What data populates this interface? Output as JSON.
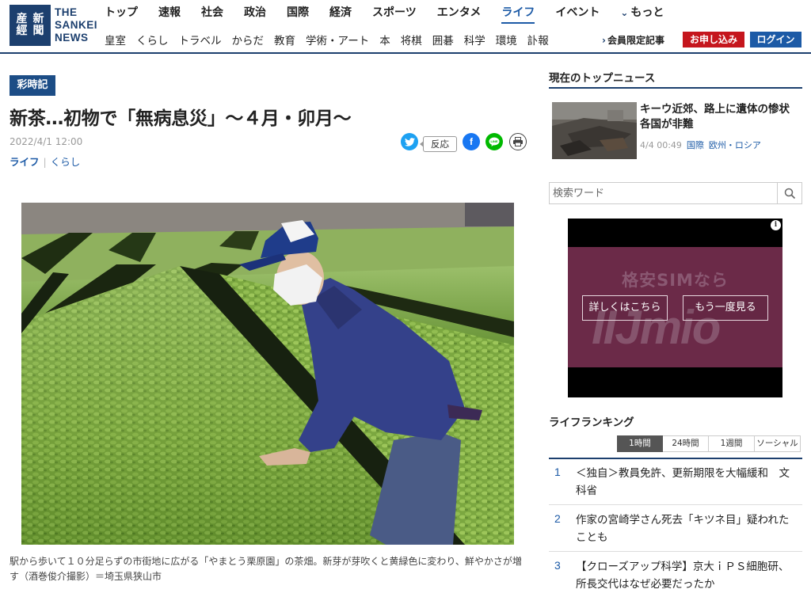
{
  "header": {
    "logo": {
      "mark": [
        "産",
        "新",
        "經",
        "聞"
      ],
      "text_lines": [
        "THE",
        "SANKEI",
        "NEWS"
      ]
    },
    "nav_main": [
      "トップ",
      "速報",
      "社会",
      "政治",
      "国際",
      "経済",
      "スポーツ",
      "エンタメ",
      "ライフ",
      "イベント"
    ],
    "nav_more": "もっと",
    "active_nav": "ライフ",
    "nav_sub": [
      "皇室",
      "くらし",
      "トラベル",
      "からだ",
      "教育",
      "学術・アート",
      "本",
      "将棋",
      "囲碁",
      "科学",
      "環境",
      "訃報"
    ],
    "member_link": "会員限定記事",
    "apply_button": "お申し込み",
    "login_button": "ログイン"
  },
  "article": {
    "badge": "彩時記",
    "title": "新茶…初物で「無病息災」～４月・卯月～",
    "date": "2022/4/1 12:00",
    "category_main": "ライフ",
    "category_sub": "くらし",
    "reaction_label": "反応",
    "share_icons": [
      "twitter-icon",
      "facebook-icon",
      "line-icon",
      "print-icon"
    ],
    "caption": "駅から歩いて１０分足らずの市街地に広がる「やまとう栗原園」の茶畑。新芽が芽吹くと黄緑色に変わり、鮮やかさが増す（酒巻俊介撮影）＝埼玉県狭山市"
  },
  "sidebar": {
    "top_news_heading": "現在のトップニュース",
    "top_news": {
      "title": "キーウ近郊、路上に遺体の惨状　各国が非難",
      "time": "4/4 00:49",
      "categories": [
        "国際",
        "欧州・ロシア"
      ]
    },
    "search_placeholder": "検索ワード",
    "ad": {
      "bg_text": "格安SIMなら",
      "bg_brand": "IIJmio",
      "button_details": "詳しくはこちら",
      "button_replay": "もう一度見る"
    },
    "ranking_heading": "ライフランキング",
    "ranking_tabs": [
      "1時間",
      "24時間",
      "1週間",
      "ソーシャル"
    ],
    "active_tab": "1時間",
    "ranking": [
      {
        "rank": "1",
        "title": "＜独自＞教員免許、更新期限を大幅緩和　文科省"
      },
      {
        "rank": "2",
        "title": "作家の宮崎学さん死去「キツネ目」疑われたことも"
      },
      {
        "rank": "3",
        "title": "【クローズアップ科学】京大ｉＰＳ細胞研、所長交代はなぜ必要だったか"
      }
    ]
  },
  "colors": {
    "brand_navy": "#1c3f6e",
    "link_blue": "#1c5aa6",
    "apply_red": "#c5161d"
  }
}
